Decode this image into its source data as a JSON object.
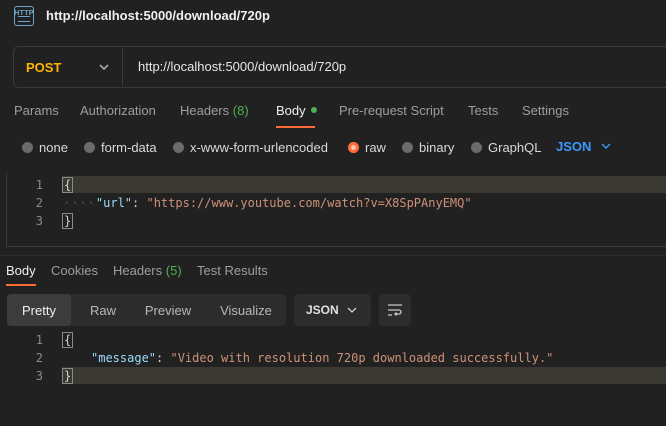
{
  "window": {
    "title": "http://localhost:5000/download/720p",
    "app_icon": "http-request-icon"
  },
  "request": {
    "method": "POST",
    "url": "http://localhost:5000/download/720p"
  },
  "request_tabs": [
    {
      "label": "Params"
    },
    {
      "label": "Authorization"
    },
    {
      "label": "Headers",
      "count": "(8)"
    },
    {
      "label": "Body",
      "active": true
    },
    {
      "label": "Pre-request Script"
    },
    {
      "label": "Tests"
    },
    {
      "label": "Settings"
    }
  ],
  "body_types": [
    {
      "label": "none"
    },
    {
      "label": "form-data"
    },
    {
      "label": "x-www-form-urlencoded"
    },
    {
      "label": "raw",
      "selected": true
    },
    {
      "label": "binary"
    },
    {
      "label": "GraphQL"
    }
  ],
  "raw_format": "JSON",
  "request_body": {
    "lines": [
      "1",
      "2",
      "3"
    ],
    "open_brace": "{",
    "key": "\"url\"",
    "colon": ": ",
    "value": "\"https://www.youtube.com/watch?v=X8SpPAnyEMQ\"",
    "indent": "····",
    "close_brace": "}"
  },
  "response_tabs": [
    {
      "label": "Body",
      "active": true
    },
    {
      "label": "Cookies"
    },
    {
      "label": "Headers",
      "count": "(5)"
    },
    {
      "label": "Test Results"
    }
  ],
  "response_views": [
    {
      "label": "Pretty",
      "active": true
    },
    {
      "label": "Raw"
    },
    {
      "label": "Preview"
    },
    {
      "label": "Visualize"
    }
  ],
  "response_format": "JSON",
  "response_body": {
    "lines": [
      "1",
      "2",
      "3"
    ],
    "open_brace": "{",
    "key": "\"message\"",
    "colon": ": ",
    "value": "\"Video with resolution 720p downloaded successfully.\"",
    "close_brace": "}"
  },
  "colors": {
    "background": "#212121",
    "accent": "#ff6c37",
    "method_post": "#ffb400",
    "json_link": "#3b99fc",
    "count_green": "#4caf50"
  }
}
